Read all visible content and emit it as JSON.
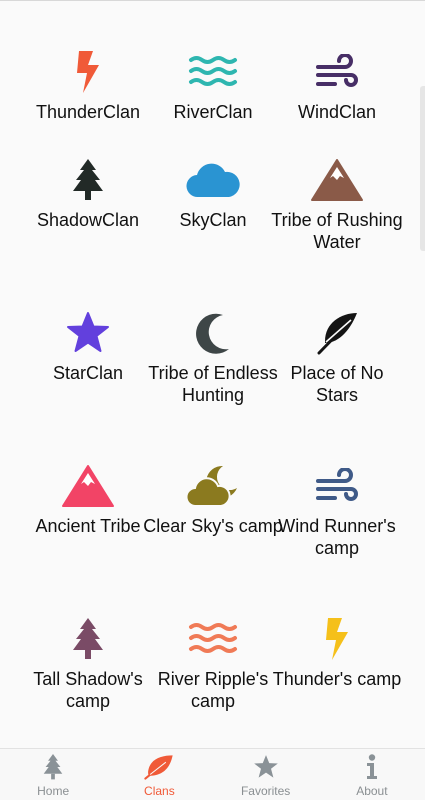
{
  "colors": {
    "thunder": "#f05a38",
    "river": "#2eb6b0",
    "wind": "#472e66",
    "shadow": "#222a27",
    "sky": "#2a94d2",
    "rushing": "#8a5a48",
    "star": "#6240dd",
    "endless": "#3e4647",
    "nostars": "#141414",
    "ancient": "#f24466",
    "clearsky": "#8b7a1f",
    "windrunner": "#3f5a88",
    "tallshadow": "#7a4b66",
    "riverripple": "#f07a56",
    "thundercamp": "#f5c01a",
    "nav_inactive": "#8a9297",
    "nav_active": "#f05a38"
  },
  "clans": [
    {
      "label": "ThunderClan",
      "icon": "lightning-icon"
    },
    {
      "label": "RiverClan",
      "icon": "waves-icon"
    },
    {
      "label": "WindClan",
      "icon": "wind-icon"
    },
    {
      "label": "ShadowClan",
      "icon": "pine-tree-icon"
    },
    {
      "label": "SkyClan",
      "icon": "cloud-icon"
    },
    {
      "label": "Tribe of Rushing Water",
      "icon": "mountain-icon"
    },
    {
      "label": "StarClan",
      "icon": "star-icon"
    },
    {
      "label": "Tribe of Endless Hunting",
      "icon": "moon-icon"
    },
    {
      "label": "Place of No Stars",
      "icon": "feather-icon"
    },
    {
      "label": "Ancient Tribe",
      "icon": "mountain-icon"
    },
    {
      "label": "Clear Sky's camp",
      "icon": "cloud-moon-icon"
    },
    {
      "label": "Wind Runner's camp",
      "icon": "wind-icon"
    },
    {
      "label": "Tall Shadow's camp",
      "icon": "pine-tree-icon"
    },
    {
      "label": "River Ripple's camp",
      "icon": "waves-icon"
    },
    {
      "label": "Thunder's camp",
      "icon": "lightning-icon"
    }
  ],
  "nav": [
    {
      "label": "Home",
      "icon": "pine-tree-icon",
      "active": false
    },
    {
      "label": "Clans",
      "icon": "leaf-icon",
      "active": true
    },
    {
      "label": "Favorites",
      "icon": "star-icon",
      "active": false
    },
    {
      "label": "About",
      "icon": "info-icon",
      "active": false
    }
  ]
}
